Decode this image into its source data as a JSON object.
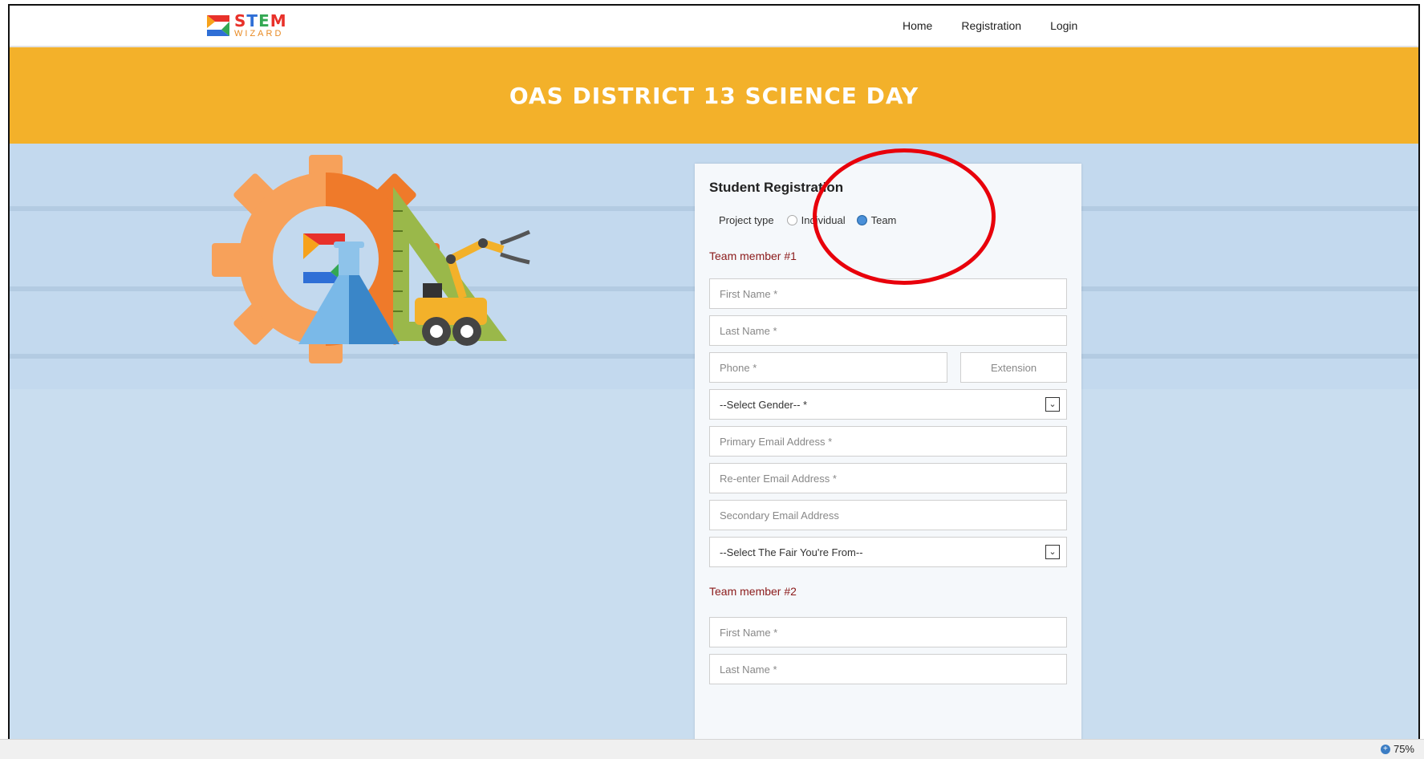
{
  "navbar": {
    "logo_top": "STEM",
    "logo_bottom": "WIZARD",
    "links": [
      "Home",
      "Registration",
      "Login"
    ]
  },
  "banner": {
    "title": "OAS DISTRICT 13 SCIENCE DAY"
  },
  "form": {
    "title": "Student Registration",
    "project_type_label": "Project type",
    "options": [
      "Individual",
      "Team"
    ],
    "selected": "Team",
    "member1": {
      "heading": "Team member #1",
      "first_name": "First Name *",
      "last_name": "Last Name *",
      "phone": "Phone *",
      "extension": "Extension",
      "gender": "--Select Gender-- *",
      "primary_email": "Primary Email Address *",
      "reenter_email": "Re-enter Email Address *",
      "secondary_email": "Secondary Email Address",
      "fair": "--Select The Fair You're From--"
    },
    "member2": {
      "heading": "Team member #2",
      "first_name": "First Name *",
      "last_name": "Last Name *"
    }
  },
  "status": {
    "zoom": "75%"
  },
  "colors": {
    "banner": "#f3b12a",
    "background": "#c9ddef",
    "annotation_ring": "#e8000b",
    "section_heading": "#8b1a1a"
  }
}
